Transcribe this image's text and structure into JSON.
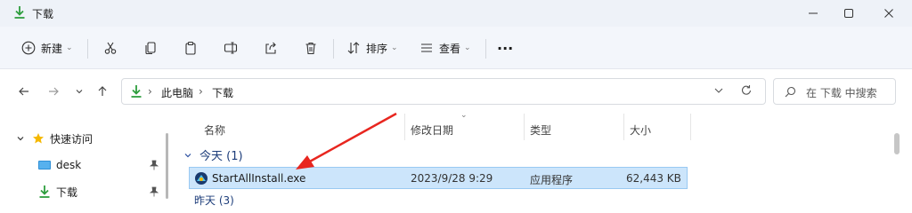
{
  "window": {
    "title": "下载",
    "minimize_label": "Minimize",
    "maximize_label": "Maximize",
    "close_label": "Close"
  },
  "toolbar": {
    "new_label": "新建",
    "sort_label": "排序",
    "view_label": "查看",
    "more_label": "···"
  },
  "address": {
    "crumbs": [
      "此电脑",
      "下载"
    ],
    "search_placeholder": "在 下载 中搜索"
  },
  "nav": {
    "items": [
      {
        "label": "快速访问",
        "icon": "star-icon"
      },
      {
        "label": "desk",
        "icon": "desktop-icon"
      },
      {
        "label": "下载",
        "icon": "download-icon"
      }
    ]
  },
  "columns": {
    "name": "名称",
    "modified": "修改日期",
    "type": "类型",
    "size": "大小"
  },
  "groups": [
    {
      "label": "今天 (1)",
      "files": [
        {
          "name": "StartAllInstall.exe",
          "modified": "2023/9/28 9:29",
          "type": "应用程序",
          "size": "62,443 KB"
        }
      ]
    }
  ],
  "next_group_label": "昨天 (3)",
  "colors": {
    "accent": "#1a73e8",
    "selection": "#cce5fb",
    "annotation_arrow": "#e8261f",
    "download_green": "#2e9e3e",
    "star_yellow": "#f5b800"
  }
}
